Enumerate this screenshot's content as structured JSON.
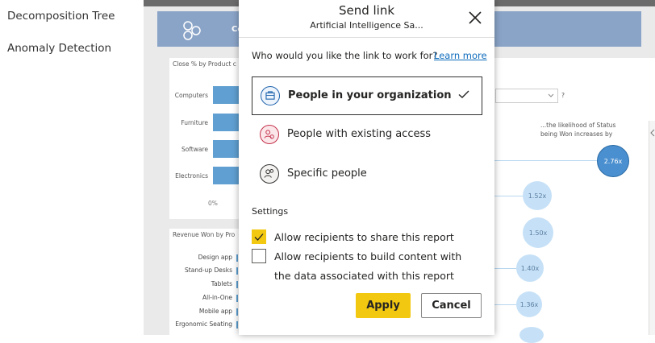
{
  "nav": {
    "items": [
      {
        "label": "Decomposition Tree"
      },
      {
        "label": "Anomaly Detection"
      }
    ]
  },
  "report": {
    "banner_title": "Cont",
    "close_chart": {
      "title": "Close % by Product c",
      "categories": [
        "Computers",
        "Furniture",
        "Software",
        "Electronics"
      ],
      "axis_label": "0%"
    },
    "revenue_chart": {
      "title": "Revenue Won by Pro",
      "categories": [
        "Design app",
        "Stand-up Desks",
        "Tablets",
        "All-in-One",
        "Mobile app",
        "Ergonomic Seating"
      ]
    },
    "insight_text_1": "...the likelihood of Status",
    "insight_text_2": "being Won increases by",
    "question_mark": "?",
    "bubbles": [
      "2.76x",
      "1.52x",
      "1.50x",
      "1.40x",
      "1.36x"
    ]
  },
  "dialog": {
    "title": "Send link",
    "subtitle": "Artificial Intelligence Sa...",
    "question": "Who would you like the link to work for?",
    "learn_more": "Learn more",
    "options": [
      {
        "label": "People in your organization",
        "selected": true
      },
      {
        "label": "People with existing access",
        "selected": false
      },
      {
        "label": "Specific people",
        "selected": false
      }
    ],
    "settings_heading": "Settings",
    "settings": [
      {
        "label": "Allow recipients to share this report",
        "checked": true
      },
      {
        "label": "Allow recipients to build content with the data associated with this report",
        "checked": false
      }
    ],
    "apply_label": "Apply",
    "cancel_label": "Cancel"
  },
  "colors": {
    "accent_yellow": "#f2c811",
    "link_blue": "#0f6cbd",
    "banner_blue": "#8aa4c8",
    "bar_blue": "#5f9fd1"
  }
}
